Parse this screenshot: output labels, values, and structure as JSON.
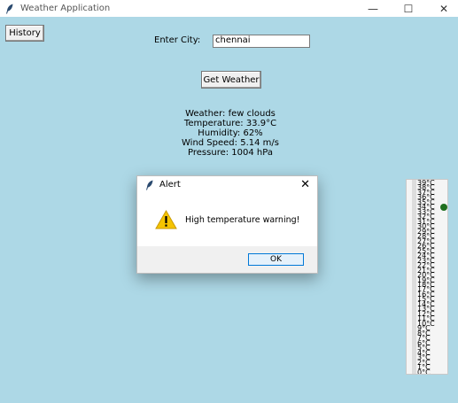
{
  "window": {
    "title": "Weather Application",
    "minimize": "—",
    "maximize": "☐",
    "close": "✕"
  },
  "history_button": "History",
  "city_label": "Enter City:",
  "city_value": "chennai",
  "get_weather_button": "Get Weather",
  "weather": {
    "condition": "Weather: few clouds",
    "temperature": "Temperature: 33.9°C",
    "humidity": "Humidity: 62%",
    "wind": "Wind Speed: 5.14 m/s",
    "pressure": "Pressure: 1004 hPa"
  },
  "dialog": {
    "title": "Alert",
    "close": "✕",
    "message": "High temperature warning!",
    "ok": "OK"
  },
  "scale": {
    "ticks": [
      "39°C",
      "38°C",
      "37°C",
      "36°C",
      "35°C",
      "34°C",
      "33°C",
      "32°C",
      "31°C",
      "30°C",
      "29°C",
      "28°C",
      "27°C",
      "26°C",
      "25°C",
      "24°C",
      "23°C",
      "22°C",
      "21°C",
      "20°C",
      "19°C",
      "18°C",
      "17°C",
      "16°C",
      "15°C",
      "14°C",
      "13°C",
      "12°C",
      "11°C",
      "10°C",
      "9°C",
      "8°C",
      "7°C",
      "6°C",
      "5°C",
      "4°C",
      "3°C",
      "2°C",
      "1°C",
      "0°C"
    ],
    "value": 34
  },
  "colors": {
    "background": "#add8e6",
    "warning": "#f5c400",
    "ok_border": "#0078d7"
  }
}
